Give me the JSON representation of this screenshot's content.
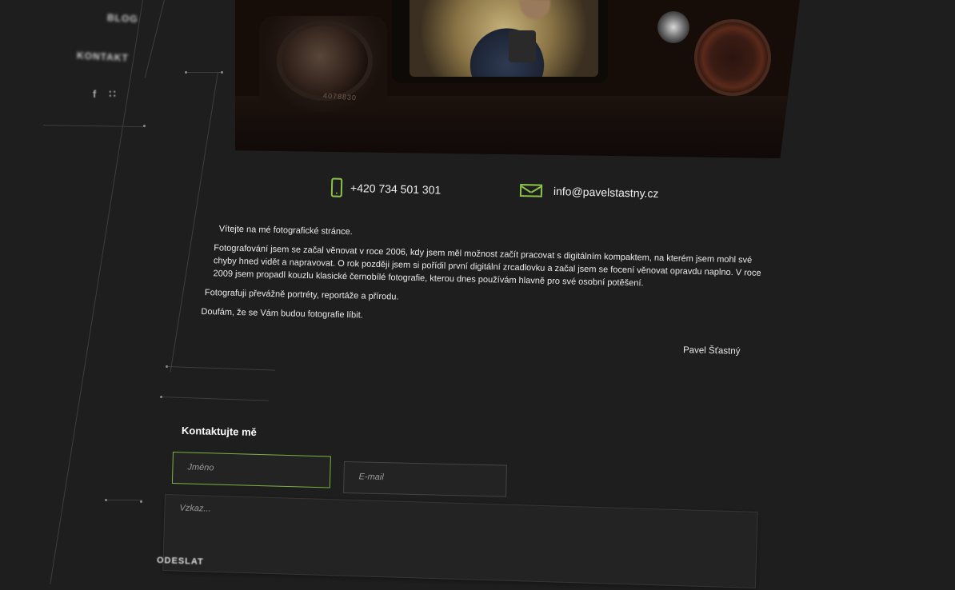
{
  "nav": {
    "items": [
      {
        "label": "BLOG"
      },
      {
        "label": "KONTAKT"
      }
    ],
    "social": [
      {
        "icon": "facebook-icon",
        "glyph": "f"
      },
      {
        "icon": "rss-icon",
        "glyph": "∷"
      }
    ]
  },
  "hero": {
    "camera_serial": "4078830"
  },
  "contact": {
    "phone": "+420 734 501 301",
    "email": "info@pavelstastny.cz",
    "icon_color": "#8bc34a"
  },
  "intro": {
    "paragraphs": [
      "Vítejte na mé fotografické stránce.",
      "Fotografování jsem se začal věnovat v roce 2006, kdy jsem měl možnost začít pracovat s digitálním kompaktem, na kterém jsem mohl své chyby hned vidět a napravovat. O rok později jsem si pořídil první digitální zrcadlovku a začal jsem se focení věnovat opravdu naplno. V roce 2009 jsem propadl kouzlu klasické černobílé fotografie, kterou dnes používám hlavně pro své osobní potěšení.",
      "Fotografuji převážně portréty, reportáže a přírodu.",
      "Doufám, že se Vám budou fotografie líbit."
    ],
    "signature": "Pavel Šťastný"
  },
  "form": {
    "title": "Kontaktujte mě",
    "name_placeholder": "Jméno",
    "email_placeholder": "E-mail",
    "message_placeholder": "Vzkaz...",
    "submit_label": "ODESLAT",
    "accent": "#7cb342"
  }
}
